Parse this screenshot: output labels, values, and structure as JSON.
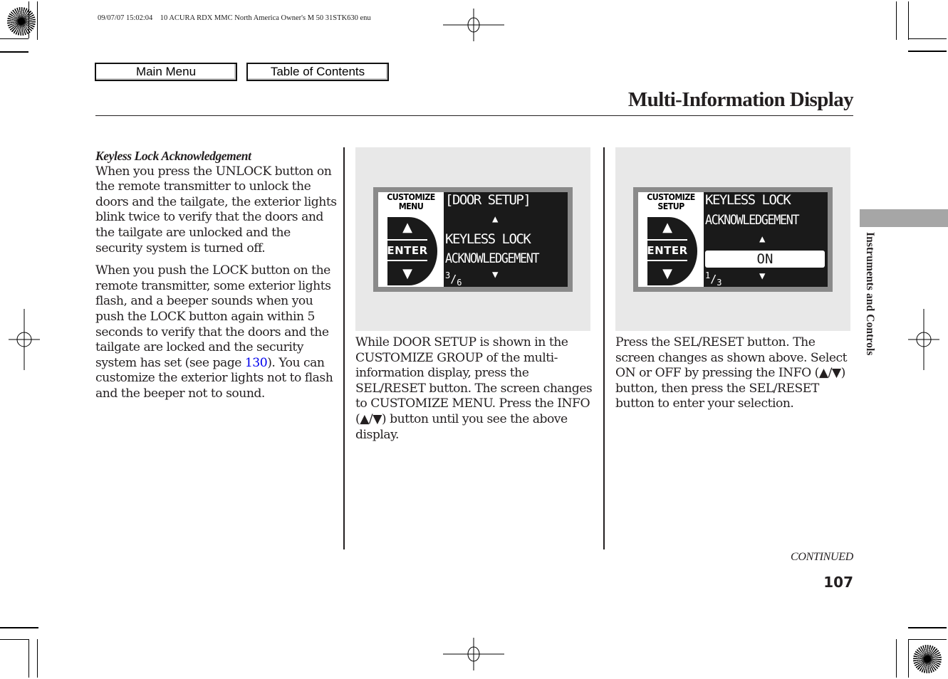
{
  "header": {
    "print_meta": "09/07/07 15:02:04    10 ACURA RDX MMC North America Owner's M 50 31STK630 enu"
  },
  "nav": {
    "main_menu": "Main Menu",
    "table_of_contents": "Table of Contents"
  },
  "page": {
    "title": "Multi-Information Display",
    "section_tab": "Instruments and Controls",
    "continued": "CONTINUED",
    "page_number": "107"
  },
  "left_column": {
    "subheading": "Keyless Lock Acknowledgement",
    "paragraph1": "When you press the UNLOCK button on the remote transmitter to unlock the doors and the tailgate, the exterior lights blink twice to verify that the doors and the tailgate are unlocked and the security system is turned off.",
    "paragraph2_before_link": "When you push the LOCK button on the remote transmitter, some exterior lights flash, and a beeper sounds when you push the LOCK button again within 5 seconds to verify that the doors and the tailgate are locked and the security system has set (see page ",
    "paragraph2_link": "130",
    "paragraph2_after_link": "). You can customize the exterior lights not to flash and the beeper not to sound."
  },
  "figure1": {
    "panel_heading_line1": "CUSTOMIZE",
    "panel_heading_line2": "MENU",
    "enter_label": "ENTER",
    "up_arrow": "▲",
    "down_arrow": "▼",
    "line1": "[DOOR SETUP]",
    "line2": "KEYLESS LOCK",
    "line3": "ACKNOWLEDGEMENT",
    "page_current": "3",
    "page_total": "6",
    "caption": "While DOOR SETUP is shown in the CUSTOMIZE GROUP of the multi-information display, press the SEL/RESET button. The screen changes to CUSTOMIZE MENU. Press the INFO (▲/▼) button until you see the above display."
  },
  "figure2": {
    "panel_heading_line1": "CUSTOMIZE",
    "panel_heading_line2": "SETUP",
    "enter_label": "ENTER",
    "up_arrow": "▲",
    "down_arrow": "▼",
    "line1": "KEYLESS LOCK",
    "line2": "ACKNOWLEDGEMENT",
    "selected_option": "ON",
    "page_current": "1",
    "page_total": "3",
    "caption": "Press the SEL/RESET button. The screen changes as shown above. Select ON or OFF by pressing the INFO (▲/▼) button, then press the SEL/RESET button to enter your selection."
  },
  "colors": {
    "link": "#0000ee",
    "text": "#231f20",
    "figure_background": "#e8e8e8",
    "lcd_background": "#1a1a1a",
    "section_tab": "#a6a6a6"
  }
}
